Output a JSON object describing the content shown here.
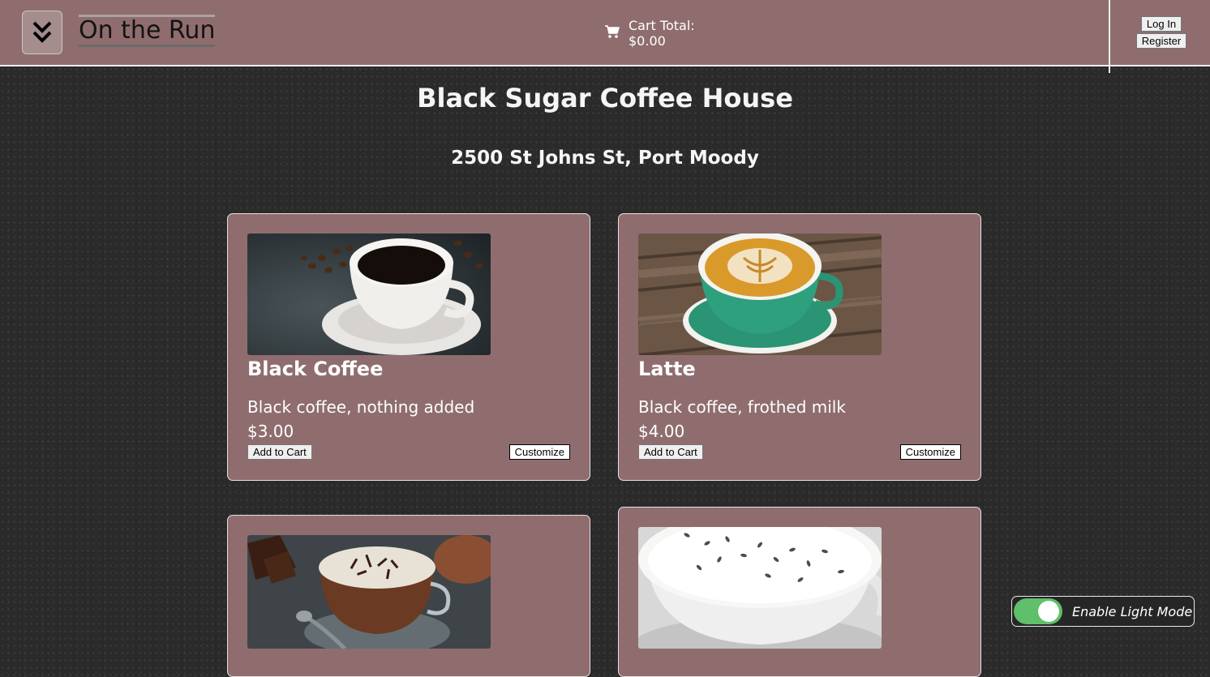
{
  "header": {
    "brand": "On the Run",
    "cart_label": "Cart Total:",
    "cart_total": "$0.00",
    "login_label": "Log In",
    "register_label": "Register"
  },
  "store": {
    "name": "Black Sugar Coffee House",
    "address": "2500 St Johns St, Port Moody"
  },
  "items": [
    {
      "name": "Black Coffee",
      "description": "Black coffee, nothing added",
      "price": "$3.00",
      "add_label": "Add to Cart",
      "customize_label": "Customize"
    },
    {
      "name": "Latte",
      "description": "Black coffee, frothed milk",
      "price": "$4.00",
      "add_label": "Add to Cart",
      "customize_label": "Customize"
    },
    {
      "name": "",
      "description": "",
      "price": ""
    },
    {
      "name": "",
      "description": "",
      "price": ""
    }
  ],
  "toggle": {
    "label": "Enable Light Mode",
    "enabled": true
  },
  "colors": {
    "header_bg": "#8f6d6f",
    "card_bg": "#8f6d6f",
    "page_bg": "#2b2a2a",
    "toggle_on": "#5fbf6a"
  }
}
